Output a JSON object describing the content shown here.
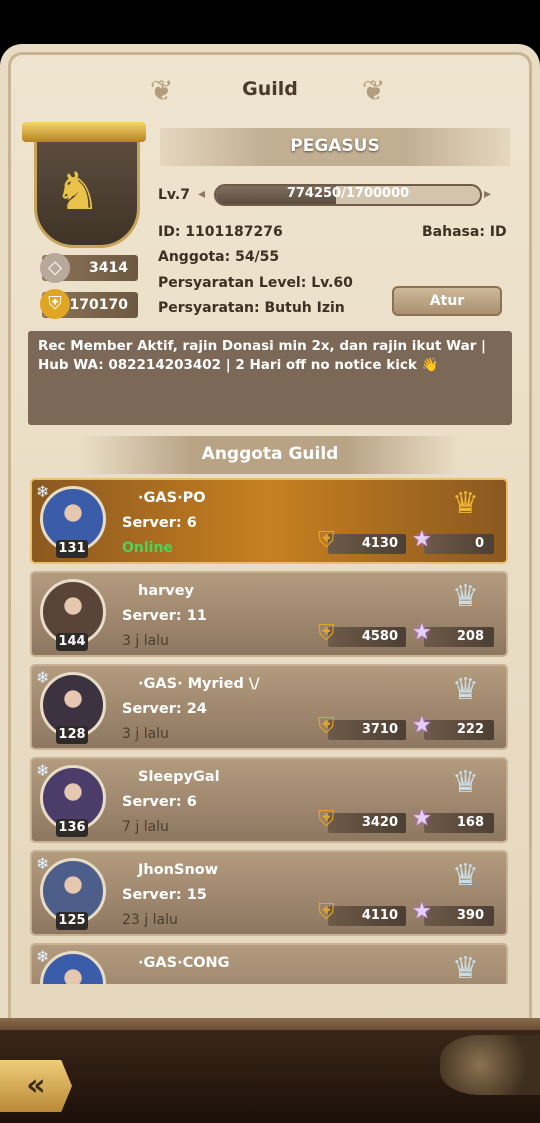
{
  "header": {
    "title": "Guild"
  },
  "guild": {
    "name": "PEGASUS",
    "level": "Lv.7",
    "xp": "774250/1700000",
    "xp_fraction": 0.455,
    "id": "ID: 1101187276",
    "language": "Bahasa: ID",
    "members": "Anggota: 54/55",
    "level_requirement": "Persyaratan Level: Lv.60",
    "join_requirement": "Persyaratan: Butuh Izin",
    "stat_rank": "3414",
    "stat_power": "170170",
    "settings_button": "Atur",
    "notice": "Rec Member Aktif, rajin Donasi min 2x, dan rajin ikut War | Hub WA: 082214203402 | 2 Hari off  no notice kick 👋"
  },
  "section": {
    "title": "Anggota Guild"
  },
  "members": [
    {
      "name": "·GAS·PO",
      "server": "Server: 6",
      "status": "Online",
      "level": "131",
      "power": "4130",
      "stars": "0",
      "rank_icon": "gold-crown-icon",
      "avatar_color": "#3b5ca8"
    },
    {
      "name": "harvey",
      "server": "Server: 11",
      "status": "3 j lalu",
      "level": "144",
      "power": "4580",
      "stars": "208",
      "rank_icon": "silver-crown-icon",
      "avatar_color": "#5a4438"
    },
    {
      "name": "·GAS· Myried \\/",
      "server": "Server: 24",
      "status": "3 j lalu",
      "level": "128",
      "power": "3710",
      "stars": "222",
      "rank_icon": "silver-crown-icon",
      "avatar_color": "#3d3340"
    },
    {
      "name": "SleepyGal",
      "server": "Server: 6",
      "status": "7 j lalu",
      "level": "136",
      "power": "3420",
      "stars": "168",
      "rank_icon": "silver-crown-icon",
      "avatar_color": "#4b3c6a"
    },
    {
      "name": "JhonSnow",
      "server": "Server: 15",
      "status": "23 j lalu",
      "level": "125",
      "power": "4110",
      "stars": "390",
      "rank_icon": "silver-crown-icon",
      "avatar_color": "#4e5e8a"
    },
    {
      "name": "·GAS·CONG",
      "server": "",
      "status": "",
      "level": "",
      "power": "",
      "stars": "",
      "rank_icon": "silver-crown-icon",
      "avatar_color": "#3b5ca8"
    }
  ],
  "nav": {
    "back_icon": "back-arrow-icon"
  }
}
